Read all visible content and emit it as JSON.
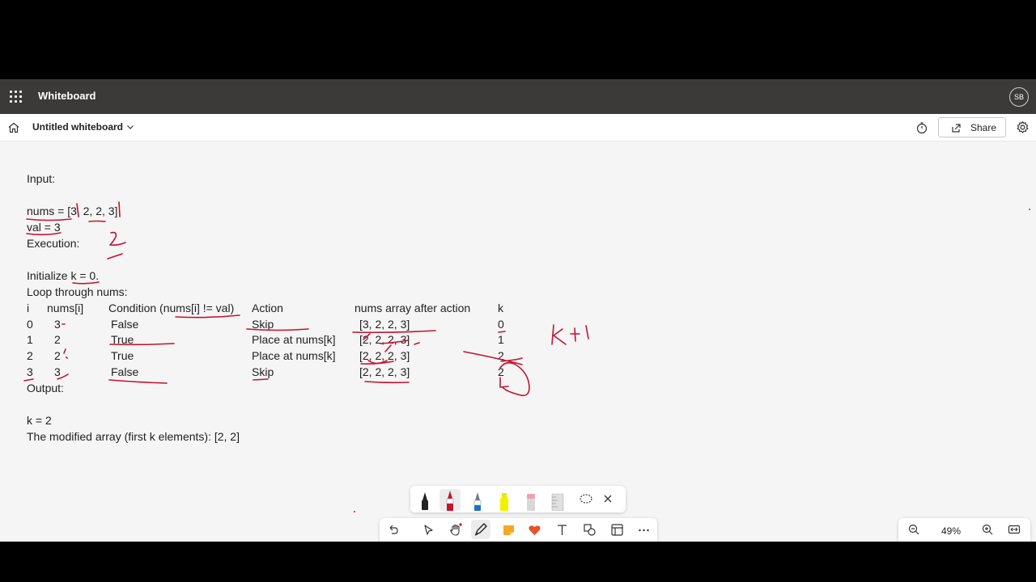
{
  "app": {
    "name": "Whiteboard",
    "user_initials": "SB"
  },
  "document": {
    "title": "Untitled whiteboard",
    "share_label": "Share"
  },
  "board": {
    "input_label": "Input:",
    "nums_line": "nums = [3, 2, 2, 3]",
    "val_line": "val = 3",
    "execution_label": "Execution:",
    "init_line": "Initialize k = 0.",
    "loop_line": "Loop through nums:",
    "table": {
      "headers": [
        "i",
        "nums[i]",
        "Condition (nums[i] != val)",
        "Action",
        "nums array after action",
        "k"
      ],
      "rows": [
        [
          "0",
          "3",
          "False",
          "Skip",
          "[3, 2, 2, 3]",
          "0"
        ],
        [
          "1",
          "2",
          "True",
          "Place at nums[k]",
          "[2, 2, 2, 3]",
          "1"
        ],
        [
          "2",
          "2",
          "True",
          "Place at nums[k]",
          "[2, 2, 2, 3]",
          "2"
        ],
        [
          "3",
          "3",
          "False",
          "Skip",
          "[2, 2, 2, 3]",
          "2"
        ]
      ]
    },
    "output_label": "Output:",
    "k_result": "k = 2",
    "modified_line": "The modified array (first k elements): [2, 2]"
  },
  "ink_colors": {
    "accent": "#c4122f"
  },
  "pen_tray": {
    "tools": [
      "black-pen",
      "red-pen",
      "blue-pen",
      "yellow-highlighter",
      "eraser",
      "ruler",
      "lasso-select"
    ]
  },
  "toolbar": {
    "tools": [
      "undo",
      "select",
      "hand-pan",
      "inking",
      "sticky-note",
      "reactions",
      "text",
      "shapes",
      "templates",
      "more"
    ]
  },
  "zoom": {
    "level": "49%"
  }
}
